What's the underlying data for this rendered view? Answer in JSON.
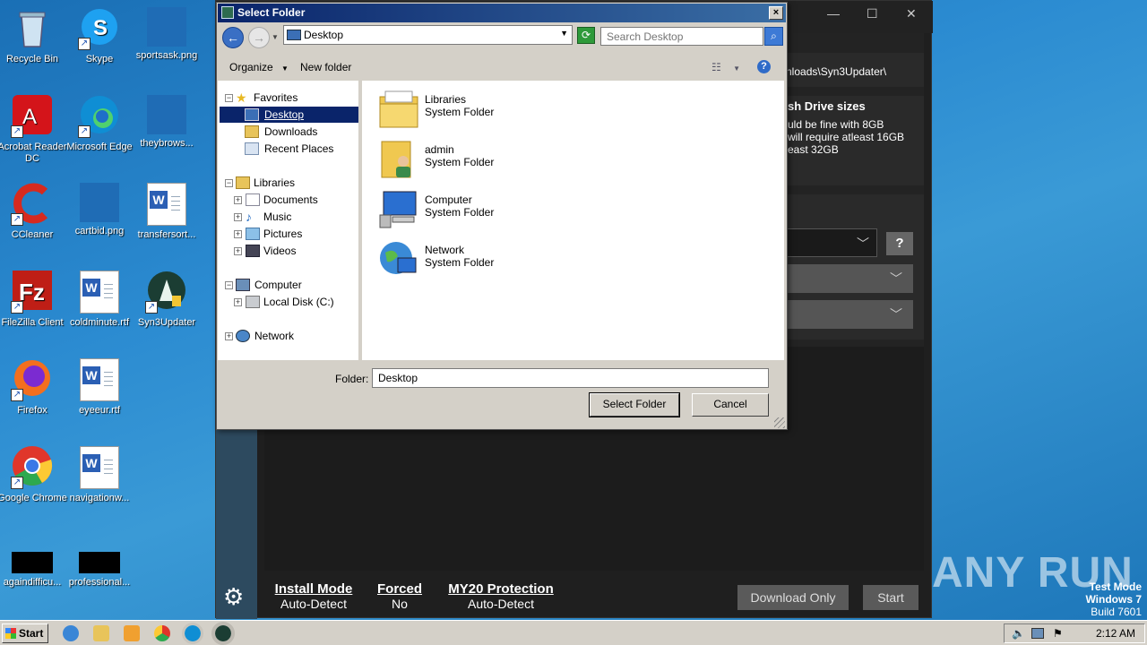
{
  "desktop": {
    "icons": [
      {
        "label": "Recycle Bin",
        "icon": "recycle-bin-icon"
      },
      {
        "label": "Skype",
        "icon": "skype-icon"
      },
      {
        "label": "sportsask.png",
        "icon": "image-file-icon"
      },
      {
        "label": "Acrobat Reader DC",
        "icon": "acrobat-icon"
      },
      {
        "label": "Microsoft Edge",
        "icon": "edge-icon"
      },
      {
        "label": "theybrows...",
        "icon": "image-file-icon"
      },
      {
        "label": "CCleaner",
        "icon": "ccleaner-icon"
      },
      {
        "label": "cartbid.png",
        "icon": "image-file-icon"
      },
      {
        "label": "transfersort...",
        "icon": "word-doc-icon"
      },
      {
        "label": "FileZilla Client",
        "icon": "filezilla-icon"
      },
      {
        "label": "coldminute.rtf",
        "icon": "word-doc-icon"
      },
      {
        "label": "Syn3Updater",
        "icon": "syn3updater-icon"
      },
      {
        "label": "Firefox",
        "icon": "firefox-icon"
      },
      {
        "label": "eyeeur.rtf",
        "icon": "word-doc-icon"
      },
      {
        "label": "Google Chrome",
        "icon": "chrome-icon"
      },
      {
        "label": "navigationw...",
        "icon": "word-doc-icon"
      },
      {
        "label": "againdifficu...",
        "icon": "black-file-icon"
      },
      {
        "label": "professional...",
        "icon": "black-file-icon"
      }
    ]
  },
  "app": {
    "path_text": "nloads\\Syn3Updater\\",
    "heading": "sh Drive sizes",
    "line1": "uld be fine with 8GB",
    "line2": "will require atleast 16GB",
    "line3": "east 32GB",
    "help_label": "?",
    "status": {
      "install_mode_label": "Install Mode",
      "install_mode_value": "Auto-Detect",
      "forced_label": "Forced",
      "forced_value": "No",
      "my20_label": "MY20 Protection",
      "my20_value": "Auto-Detect"
    },
    "download_only_label": "Download Only",
    "start_label": "Start"
  },
  "dialog": {
    "title": "Select Folder",
    "address": "Desktop",
    "search_placeholder": "Search Desktop",
    "organize_label": "Organize",
    "new_folder_label": "New folder",
    "tree": {
      "favorites": "Favorites",
      "desktop": "Desktop",
      "downloads": "Downloads",
      "recent_places": "Recent Places",
      "libraries": "Libraries",
      "documents": "Documents",
      "music": "Music",
      "pictures": "Pictures",
      "videos": "Videos",
      "computer": "Computer",
      "local_disk": "Local Disk (C:)",
      "network": "Network"
    },
    "files": [
      {
        "name": "Libraries",
        "type": "System Folder",
        "icon": "libraries-icon"
      },
      {
        "name": "admin",
        "type": "System Folder",
        "icon": "user-folder-icon"
      },
      {
        "name": "Computer",
        "type": "System Folder",
        "icon": "computer-icon"
      },
      {
        "name": "Network",
        "type": "System Folder",
        "icon": "network-icon"
      }
    ],
    "folder_label": "Folder:",
    "folder_value": "Desktop",
    "select_folder_label": "Select Folder",
    "cancel_label": "Cancel"
  },
  "taskbar": {
    "start_label": "Start",
    "clock": "2:12 AM"
  },
  "watermark": {
    "line1": "Test Mode",
    "line2": "Windows 7",
    "line3": "Build 7601",
    "brand": "ANY RUN"
  }
}
